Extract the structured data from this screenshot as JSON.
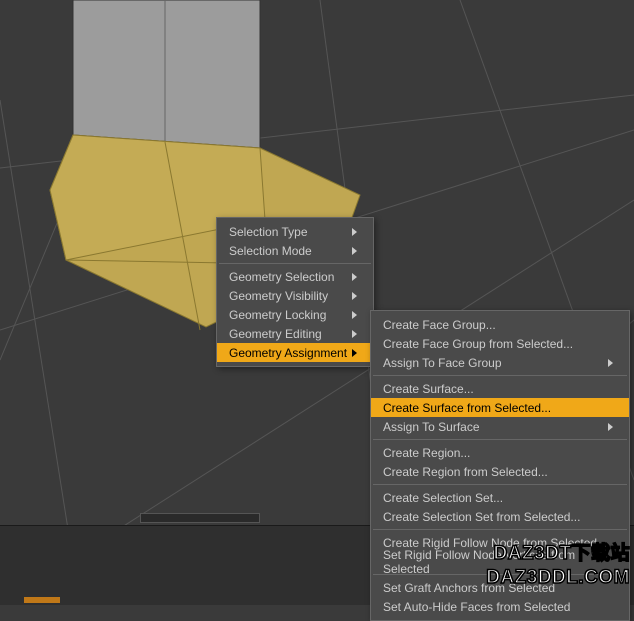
{
  "menu1": {
    "items": [
      {
        "label": "Selection Type",
        "arrow": true
      },
      {
        "label": "Selection Mode",
        "arrow": true
      },
      {
        "sep": true
      },
      {
        "label": "Geometry Selection",
        "arrow": true
      },
      {
        "label": "Geometry Visibility",
        "arrow": true
      },
      {
        "label": "Geometry Locking",
        "arrow": true
      },
      {
        "label": "Geometry Editing",
        "arrow": true
      },
      {
        "label": "Geometry Assignment",
        "arrow": true,
        "hl": true
      }
    ]
  },
  "menu2": {
    "items": [
      {
        "label": "Create Face Group..."
      },
      {
        "label": "Create Face Group from Selected..."
      },
      {
        "label": "Assign To Face Group",
        "arrow": true
      },
      {
        "sep": true
      },
      {
        "label": "Create Surface..."
      },
      {
        "label": "Create Surface from Selected...",
        "hl": true
      },
      {
        "label": "Assign To Surface",
        "arrow": true
      },
      {
        "sep": true
      },
      {
        "label": "Create Region..."
      },
      {
        "label": "Create Region from Selected..."
      },
      {
        "sep": true
      },
      {
        "label": "Create Selection Set..."
      },
      {
        "label": "Create Selection Set from Selected..."
      },
      {
        "sep": true
      },
      {
        "label": "Create Rigid Follow Node from Selected..."
      },
      {
        "label": "Set Rigid Follow Node Vertices from Selected"
      },
      {
        "sep": true
      },
      {
        "label": "Set Graft Anchors from Selected"
      },
      {
        "label": "Set Auto-Hide Faces from Selected"
      }
    ]
  },
  "watermark": {
    "line1": "DAZ3DT下载站",
    "line2": "DAZ3DDL.COM"
  }
}
